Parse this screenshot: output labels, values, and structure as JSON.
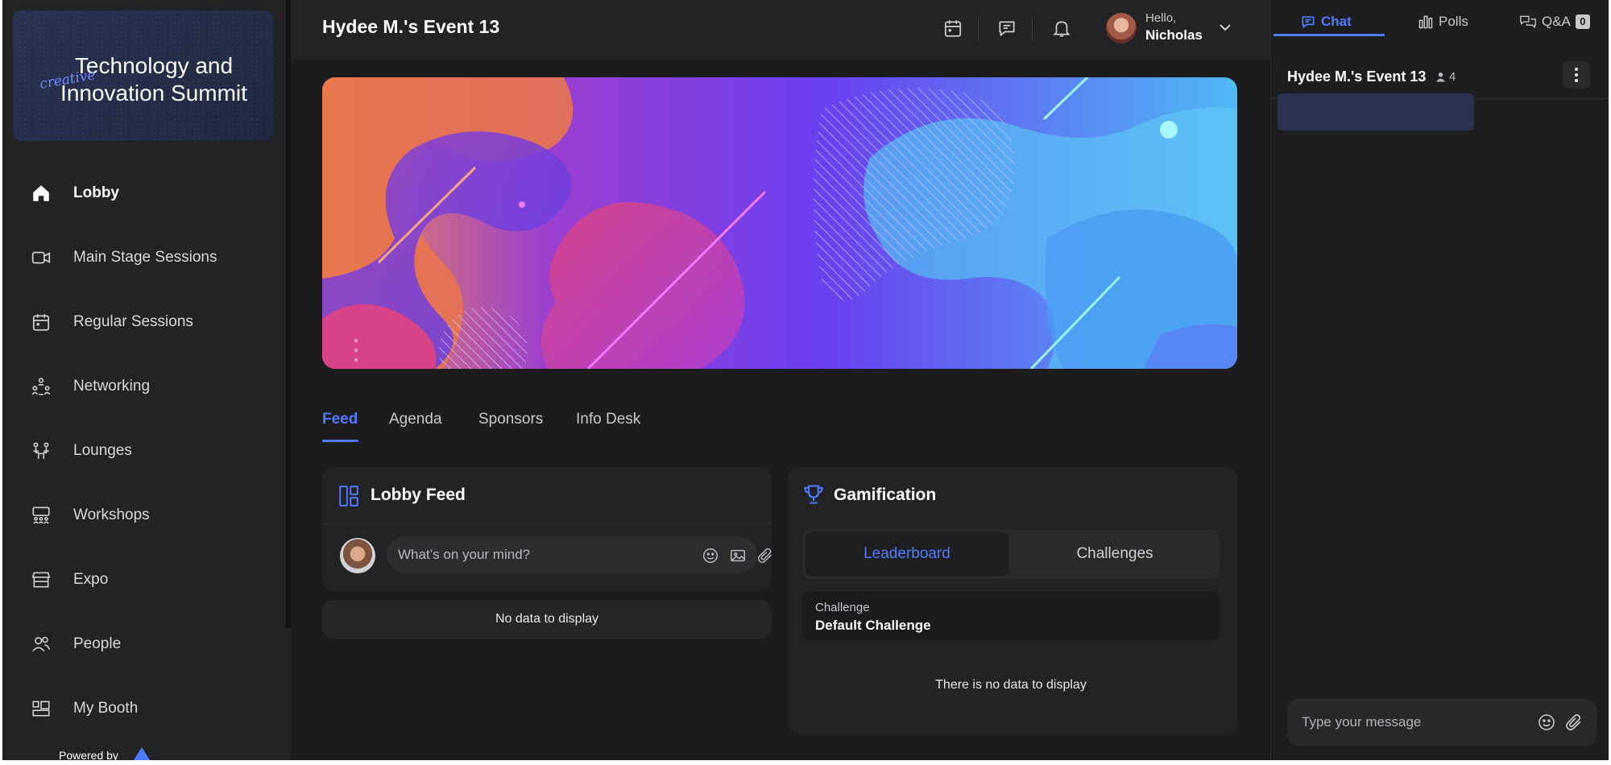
{
  "brand": {
    "title": "Technology and Innovation Summit",
    "script": "creative"
  },
  "sidebar": {
    "items": [
      {
        "label": "Lobby",
        "icon": "home-icon",
        "active": true
      },
      {
        "label": "Main Stage Sessions",
        "icon": "video-icon"
      },
      {
        "label": "Regular Sessions",
        "icon": "calendar-icon"
      },
      {
        "label": "Networking",
        "icon": "networking-icon"
      },
      {
        "label": "Lounges",
        "icon": "lounges-icon"
      },
      {
        "label": "Workshops",
        "icon": "workshops-icon"
      },
      {
        "label": "Expo",
        "icon": "store-icon"
      },
      {
        "label": "People",
        "icon": "people-icon"
      },
      {
        "label": "My Booth",
        "icon": "booth-icon"
      }
    ],
    "powered_by": "Powered by"
  },
  "header": {
    "event_title": "Hydee M.'s Event 13",
    "greeting": "Hello,",
    "user_name": "Nicholas"
  },
  "tabs": [
    {
      "label": "Feed",
      "active": true
    },
    {
      "label": "Agenda"
    },
    {
      "label": "Sponsors"
    },
    {
      "label": "Info Desk"
    }
  ],
  "lobby_feed": {
    "title": "Lobby Feed",
    "placeholder": "What’s on your mind?",
    "empty": "No data to display"
  },
  "gamification": {
    "title": "Gamification",
    "tabs": [
      "Leaderboard",
      "Challenges"
    ],
    "challenge_label": "Challenge",
    "challenge_value": "Default Challenge",
    "empty": "There is no data to display"
  },
  "right_panel": {
    "tabs": [
      {
        "label": "Chat",
        "active": true
      },
      {
        "label": "Polls"
      },
      {
        "label": "Q&A",
        "badge": "0"
      }
    ],
    "chat_title": "Hydee M.'s Event 13",
    "member_count": "4",
    "message_placeholder": "Type your message"
  },
  "colors": {
    "accent": "#4f7cff",
    "background": "#1c1c1e",
    "panel": "#232325"
  }
}
